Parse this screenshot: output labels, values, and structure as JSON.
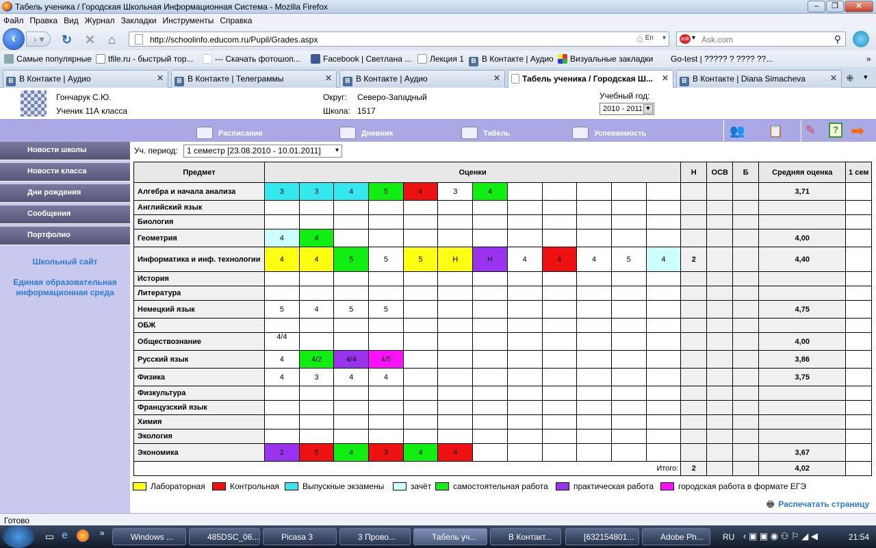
{
  "window": {
    "title": "Табель ученика / Городская Школьная Информационная Система - Mozilla Firefox"
  },
  "menu": [
    "Файл",
    "Правка",
    "Вид",
    "Журнал",
    "Закладки",
    "Инструменты",
    "Справка"
  ],
  "nav": {
    "url": "http://schoolinfo.educom.ru/Pupil/Grades.aspx",
    "search_placeholder": "Ask.com",
    "lang": "En"
  },
  "bookmarks": [
    "Самые популярные",
    "tfile.ru - быстрый тор...",
    "--- Скачать фотошоп...",
    "Facebook | Светлана ...",
    "Лекция 1",
    "В Контакте | Аудио",
    "Визуальные закладки",
    "Go-test | ????? ? ???? ??..."
  ],
  "tabs": [
    {
      "label": "В Контакте | Аудио"
    },
    {
      "label": "В Контакте | Телеграммы"
    },
    {
      "label": "В Контакте | Аудио"
    },
    {
      "label": "Табель ученика / Городская Ш..."
    },
    {
      "label": "В Контакте | Diana Simacheva"
    }
  ],
  "header": {
    "name": "Гончарук С.Ю.",
    "role": "Ученик 11А класса",
    "okrug_label": "Округ:",
    "okrug": "Северо-Западный",
    "school_label": "Школа:",
    "school": "1517",
    "year_label": "Учебный год:",
    "year": "2010 - 2011"
  },
  "topnav": [
    "Расписание",
    "Дневник",
    "Табель",
    "Успеваемость"
  ],
  "sidebar": {
    "buttons": [
      "Новости школы",
      "Новости класса",
      "Дни рождения",
      "Сообщения",
      "Портфолио"
    ],
    "links": [
      "Школьный сайт",
      "Единая образовательная информационная среда"
    ]
  },
  "period": {
    "label": "Уч. период:",
    "value": "1 семестр [23.08.2010 - 10.01.2011]"
  },
  "table": {
    "headers": {
      "subject": "Предмет",
      "grades": "Оценки",
      "n": "Н",
      "osv": "ОСВ",
      "b": "Б",
      "avg": "Средняя оценка",
      "sem": "1 сем"
    },
    "rows": [
      {
        "subject": "Алгебра и начала анализа",
        "grades": [
          [
            "3",
            "#33e8ee"
          ],
          [
            "3",
            "#33e8ee"
          ],
          [
            "4",
            "#33e8ee"
          ],
          [
            "5",
            "#11ee11"
          ],
          [
            "4",
            "#ee1111"
          ],
          [
            "3",
            ""
          ],
          [
            "4",
            "#11ee11"
          ]
        ],
        "n": "",
        "avg": "3,71"
      },
      {
        "subject": "Английский язык",
        "grades": [],
        "n": "",
        "avg": ""
      },
      {
        "subject": "Биология",
        "grades": [],
        "n": "",
        "avg": ""
      },
      {
        "subject": "Геометрия",
        "grades": [
          [
            "4",
            "#ccffff"
          ],
          [
            "4",
            "#11ee11"
          ]
        ],
        "n": "",
        "avg": "4,00"
      },
      {
        "subject": "Информатика и инф. технологии",
        "grades": [
          [
            "4",
            "#ffff11"
          ],
          [
            "4",
            "#ffff11"
          ],
          [
            "5",
            "#11ee11"
          ],
          [
            "5",
            ""
          ],
          [
            "5",
            "#ffff11"
          ],
          [
            "Н",
            "#ffff11"
          ],
          [
            "Н",
            "#9933ee"
          ],
          [
            "4",
            ""
          ],
          [
            "4",
            "#ee1111"
          ],
          [
            "4",
            ""
          ],
          [
            "5",
            ""
          ],
          [
            "4",
            "#ccffff"
          ]
        ],
        "n": "2",
        "avg": "4,40"
      },
      {
        "subject": "История",
        "grades": [],
        "n": "",
        "avg": ""
      },
      {
        "subject": "Литература",
        "grades": [],
        "n": "",
        "avg": ""
      },
      {
        "subject": "Немецкий язык",
        "grades": [
          [
            "5",
            ""
          ],
          [
            "4",
            ""
          ],
          [
            "5",
            ""
          ],
          [
            "5",
            ""
          ]
        ],
        "n": "",
        "avg": "4,75"
      },
      {
        "subject": "ОБЖ",
        "grades": [],
        "n": "",
        "avg": ""
      },
      {
        "subject": "Обществознание",
        "grades": [
          [
            "4/4",
            ""
          ]
        ],
        "n": "",
        "avg": "4,00"
      },
      {
        "subject": "Русский язык",
        "grades": [
          [
            "4",
            ""
          ],
          [
            "4/2",
            "#11ee11"
          ],
          [
            "4/4",
            "#9933ee"
          ],
          [
            "4/5",
            "#ff11ff"
          ]
        ],
        "n": "",
        "avg": "3,86"
      },
      {
        "subject": "Физика",
        "grades": [
          [
            "4",
            ""
          ],
          [
            "3",
            ""
          ],
          [
            "4",
            ""
          ],
          [
            "4",
            ""
          ]
        ],
        "n": "",
        "avg": "3,75"
      },
      {
        "subject": "Физкультура",
        "grades": [],
        "n": "",
        "avg": ""
      },
      {
        "subject": "Французский язык",
        "grades": [],
        "n": "",
        "avg": ""
      },
      {
        "subject": "Химия",
        "grades": [],
        "n": "",
        "avg": ""
      },
      {
        "subject": "Экология",
        "grades": [],
        "n": "",
        "avg": ""
      },
      {
        "subject": "Экономика",
        "grades": [
          [
            "2",
            "#9933ee"
          ],
          [
            "5",
            "#ee1111"
          ],
          [
            "4",
            "#11ee11"
          ],
          [
            "3",
            "#ee1111"
          ],
          [
            "4",
            "#11ee11"
          ],
          [
            "4",
            "#ee1111"
          ]
        ],
        "n": "",
        "avg": "3,67"
      }
    ],
    "total": {
      "label": "Итого:",
      "n": "2",
      "avg": "4,02"
    }
  },
  "legend": [
    {
      "label": "Лабораторная",
      "color": "#ffff11"
    },
    {
      "label": "Контрольная",
      "color": "#ee1111"
    },
    {
      "label": "Выпускные экзамены",
      "color": "#33e8ee"
    },
    {
      "label": "зачёт",
      "color": "#ccffff"
    },
    {
      "label": "самостоятельная работа",
      "color": "#11ee11"
    },
    {
      "label": "практическая работа",
      "color": "#9933ee"
    },
    {
      "label": "городская работа в формате ЕГЭ",
      "color": "#ff11ff"
    }
  ],
  "print_label": "Распечатать страницу",
  "status": "Готово",
  "taskbar": {
    "items": [
      "Windows ...",
      "485DSC_06...",
      "Picasa 3",
      "3 Прово...",
      "Табель уч...",
      "В Контакт...",
      "[632154801...",
      "Adobe Ph..."
    ],
    "lang": "RU",
    "time": "21:54"
  }
}
